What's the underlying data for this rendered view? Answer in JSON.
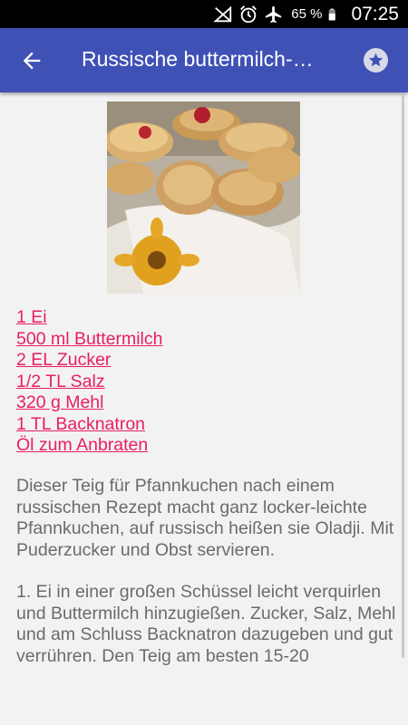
{
  "status_bar": {
    "battery_percent": "65 %",
    "time": "07:25",
    "icons": [
      "signal-muted-icon",
      "alarm-icon",
      "airplane-mode-icon",
      "battery-icon"
    ]
  },
  "app_bar": {
    "title": "Russische buttermilch-…",
    "back_icon": "arrow-left-icon",
    "favorite_icon": "star-icon",
    "color": "#3f51b5"
  },
  "recipe": {
    "ingredients": [
      "1 Ei",
      "500 ml Buttermilch",
      "2 EL Zucker",
      "1/2 TL Salz",
      "320 g Mehl",
      "1 TL Backnatron",
      "Öl zum Anbraten"
    ],
    "description": "Dieser Teig für Pfannkuchen nach einem russischen Rezept macht ganz locker-leichte Pfannkuchen, auf russisch heißen sie Oladji. Mit Puderzucker und Obst servieren.",
    "instructions": "1. Ei in einer großen Schüssel leicht verquirlen und Buttermilch hinzugießen. Zucker, Salz, Mehl und am Schluss Backnatron dazugeben und gut verrühren. Den Teig am besten 15-20",
    "link_color": "#e91e63",
    "text_color": "#6b6b6b"
  }
}
